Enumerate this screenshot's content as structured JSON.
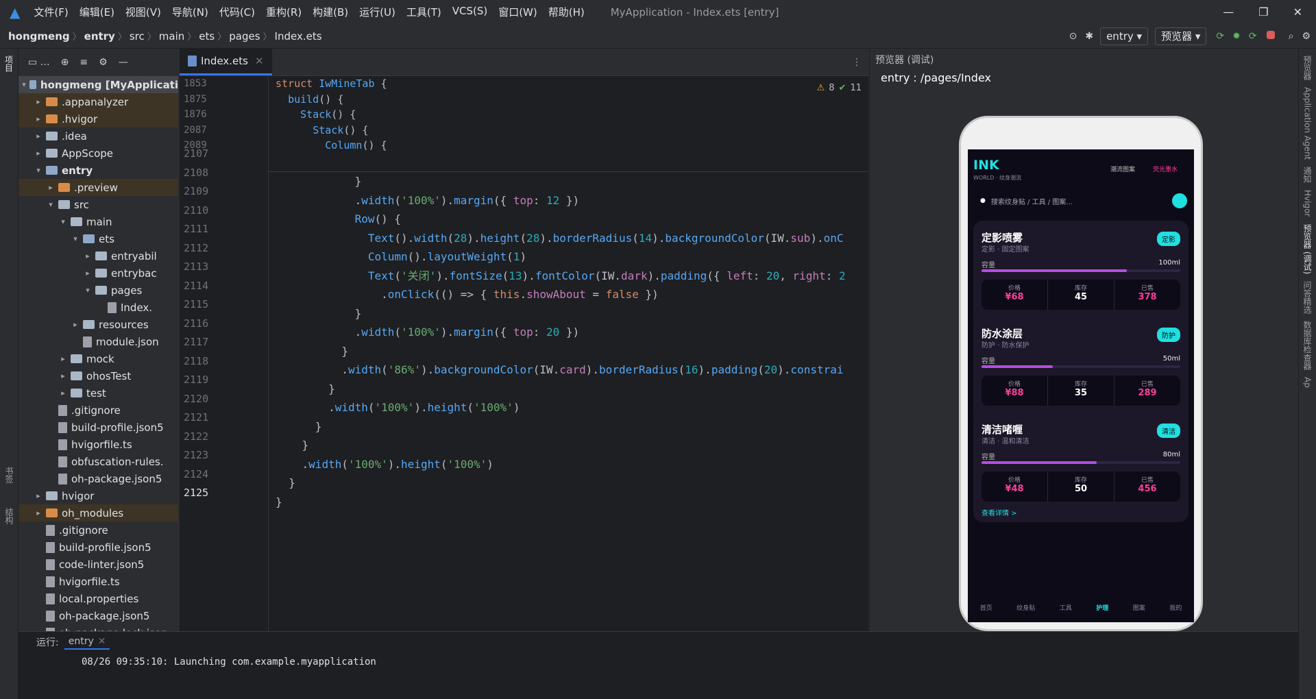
{
  "menu": {
    "items": [
      "文件(F)",
      "编辑(E)",
      "视图(V)",
      "导航(N)",
      "代码(C)",
      "重构(R)",
      "构建(B)",
      "运行(U)",
      "工具(T)",
      "VCS(S)",
      "窗口(W)",
      "帮助(H)"
    ],
    "title": "MyApplication - Index.ets [entry]"
  },
  "breadcrumb": [
    "hongmeng",
    "entry",
    "src",
    "main",
    "ets",
    "pages",
    "Index.ets"
  ],
  "toolbar": {
    "config": "entry",
    "device": "预览器"
  },
  "project": {
    "rows": [
      {
        "d": 0,
        "a": "▾",
        "i": "blue",
        "t": "hongmeng [MyApplicati",
        "sel": true
      },
      {
        "d": 1,
        "a": "▸",
        "i": "orange",
        "t": ".appanalyzer",
        "hl": true
      },
      {
        "d": 1,
        "a": "▸",
        "i": "orange",
        "t": ".hvigor",
        "hl": true
      },
      {
        "d": 1,
        "a": "▸",
        "i": "gray",
        "t": ".idea"
      },
      {
        "d": 1,
        "a": "▸",
        "i": "gray",
        "t": "AppScope"
      },
      {
        "d": 1,
        "a": "▾",
        "i": "blue",
        "t": "entry",
        "b": true
      },
      {
        "d": 2,
        "a": "▸",
        "i": "orange",
        "t": ".preview",
        "hl": true
      },
      {
        "d": 2,
        "a": "▾",
        "i": "gray",
        "t": "src"
      },
      {
        "d": 3,
        "a": "▾",
        "i": "gray",
        "t": "main"
      },
      {
        "d": 4,
        "a": "▾",
        "i": "blue",
        "t": "ets"
      },
      {
        "d": 5,
        "a": "▸",
        "i": "gray",
        "t": "entryabil"
      },
      {
        "d": 5,
        "a": "▸",
        "i": "gray",
        "t": "entrybac"
      },
      {
        "d": 5,
        "a": "▾",
        "i": "gray",
        "t": "pages"
      },
      {
        "d": 6,
        "a": "",
        "i": "file",
        "t": "Index."
      },
      {
        "d": 4,
        "a": "▸",
        "i": "gray",
        "t": "resources"
      },
      {
        "d": 4,
        "a": "",
        "i": "file",
        "t": "module.json"
      },
      {
        "d": 3,
        "a": "▸",
        "i": "gray",
        "t": "mock"
      },
      {
        "d": 3,
        "a": "▸",
        "i": "gray",
        "t": "ohosTest"
      },
      {
        "d": 3,
        "a": "▸",
        "i": "gray",
        "t": "test"
      },
      {
        "d": 2,
        "a": "",
        "i": "file",
        "t": ".gitignore"
      },
      {
        "d": 2,
        "a": "",
        "i": "file",
        "t": "build-profile.json5"
      },
      {
        "d": 2,
        "a": "",
        "i": "file",
        "t": "hvigorfile.ts"
      },
      {
        "d": 2,
        "a": "",
        "i": "file",
        "t": "obfuscation-rules."
      },
      {
        "d": 2,
        "a": "",
        "i": "file",
        "t": "oh-package.json5"
      },
      {
        "d": 1,
        "a": "▸",
        "i": "gray",
        "t": "hvigor"
      },
      {
        "d": 1,
        "a": "▸",
        "i": "orange",
        "t": "oh_modules",
        "hl": true
      },
      {
        "d": 1,
        "a": "",
        "i": "file",
        "t": ".gitignore"
      },
      {
        "d": 1,
        "a": "",
        "i": "file",
        "t": "build-profile.json5"
      },
      {
        "d": 1,
        "a": "",
        "i": "file",
        "t": "code-linter.json5"
      },
      {
        "d": 1,
        "a": "",
        "i": "file",
        "t": "hvigorfile.ts"
      },
      {
        "d": 1,
        "a": "",
        "i": "file",
        "t": "local.properties"
      },
      {
        "d": 1,
        "a": "",
        "i": "file",
        "t": "oh-package.json5"
      },
      {
        "d": 1,
        "a": "",
        "i": "file",
        "t": "oh-package-lock.json"
      }
    ]
  },
  "editor": {
    "tab": "Index.ets",
    "warnings": "8",
    "checks": "11",
    "sticky": [
      {
        "n": "1853",
        "c": "<span class='kw'>struct</span> <span class='fn'>IwMineTab</span> {"
      },
      {
        "n": "1875",
        "c": "  <span class='fn'>build</span>() {"
      },
      {
        "n": "1876",
        "c": "    <span class='fn'>Stack</span>() {"
      },
      {
        "n": "2087",
        "c": "      <span class='fn'>Stack</span>() {"
      },
      {
        "n": "2089",
        "c": "        <span class='fn'>Column</span>() {"
      }
    ],
    "lines": [
      {
        "n": "2107",
        "c": "            }"
      },
      {
        "n": "2108",
        "c": "            .<span class='fn'>width</span>(<span class='str'>'100%'</span>).<span class='fn'>margin</span>({ <span class='prop'>top</span>: <span class='num'>12</span> })"
      },
      {
        "n": "2109",
        "c": "            <span class='fn'>Row</span>() {"
      },
      {
        "n": "2110",
        "c": "              <span class='fn'>Text</span>().<span class='fn'>width</span>(<span class='num'>28</span>).<span class='fn'>height</span>(<span class='num'>28</span>).<span class='fn'>borderRadius</span>(<span class='num'>14</span>).<span class='fn'>backgroundColor</span>(IW.<span class='prop'>sub</span>).<span class='fn'>onC</span>"
      },
      {
        "n": "2111",
        "c": "              <span class='fn'>Column</span>().<span class='fn'>layoutWeight</span>(<span class='num'>1</span>)"
      },
      {
        "n": "2112",
        "c": "              <span class='fn'>Text</span>(<span class='str'>'关闭'</span>).<span class='fn'>fontSize</span>(<span class='num'>13</span>).<span class='fn'>fontColor</span>(IW.<span class='prop'>dark</span>).<span class='fn'>padding</span>({ <span class='prop'>left</span>: <span class='num'>20</span>, <span class='prop'>right</span>: <span class='num'>2</span>"
      },
      {
        "n": "2113",
        "c": "                .<span class='fn'>onClick</span>(() => { <span class='this'>this</span>.<span class='prop'>showAbout</span> = <span class='kw'>false</span> })"
      },
      {
        "n": "2114",
        "c": "            }"
      },
      {
        "n": "2115",
        "c": "            .<span class='fn'>width</span>(<span class='str'>'100%'</span>).<span class='fn'>margin</span>({ <span class='prop'>top</span>: <span class='num'>20</span> })"
      },
      {
        "n": "2116",
        "c": "          }"
      },
      {
        "n": "2117",
        "c": "          .<span class='fn'>width</span>(<span class='str'>'86%'</span>).<span class='fn'>backgroundColor</span>(IW.<span class='prop'>card</span>).<span class='fn'>borderRadius</span>(<span class='num'>16</span>).<span class='fn'>padding</span>(<span class='num'>20</span>).<span class='fn'>constrai</span>"
      },
      {
        "n": "2118",
        "c": "        }"
      },
      {
        "n": "2119",
        "c": "        .<span class='fn'>width</span>(<span class='str'>'100%'</span>).<span class='fn'>height</span>(<span class='str'>'100%'</span>)"
      },
      {
        "n": "2120",
        "c": "      }"
      },
      {
        "n": "2121",
        "c": "    }"
      },
      {
        "n": "2122",
        "c": "    .<span class='fn'>width</span>(<span class='str'>'100%'</span>).<span class='fn'>height</span>(<span class='str'>'100%'</span>)"
      },
      {
        "n": "2123",
        "c": "  }"
      },
      {
        "n": "2124",
        "c": "}"
      },
      {
        "n": "2125",
        "c": ""
      }
    ]
  },
  "preview": {
    "panel_title": "预览器 (调试)",
    "route": "entry : /pages/Index"
  },
  "app": {
    "logo": "INK",
    "logo_sub": "WORLD · 纹身潮流",
    "link1": "潮流图案",
    "link2": "荧光墨水",
    "search": "搜索纹身贴 / 工具 / 图案...",
    "cards": [
      {
        "title": "定影喷雾",
        "sub": "定影 · 固定图案",
        "badge": "定影",
        "cap": "100ml",
        "level": 0.73,
        "price": "¥68",
        "stock": "45",
        "sold": "378"
      },
      {
        "title": "防水涂层",
        "sub": "防护 · 防水保护",
        "badge": "防护",
        "cap": "50ml",
        "level": 0.36,
        "price": "¥88",
        "stock": "35",
        "sold": "289"
      },
      {
        "title": "清洁啫喱",
        "sub": "清洁 · 温和清洁",
        "badge": "清洁",
        "cap": "80ml",
        "level": 0.58,
        "price": "¥48",
        "stock": "50",
        "sold": "456"
      }
    ],
    "labels": {
      "cap": "容量",
      "price": "价格",
      "stock": "库存",
      "sold": "已售",
      "more": "查看详情 >"
    },
    "tabs": [
      "首页",
      "纹身贴",
      "工具",
      "护理",
      "图案",
      "我的"
    ],
    "active_tab": 3
  },
  "run": {
    "label": "运行:",
    "config": "entry",
    "log": "08/26 09:35:10: Launching com.example.myapplication"
  },
  "sidetabs": {
    "left_top": "项目",
    "left_bottom1": "书签",
    "left_bottom2": "结构",
    "right": [
      "预览器",
      "Application Agent",
      "通知",
      "Hvigor",
      "预览器 (调试)",
      "问答精选",
      "数据库检查器",
      "Ap"
    ]
  },
  "colors": {
    "accent": "#1fe0e0",
    "pink": "#ff3f9b",
    "purple": "#b34fe0"
  }
}
